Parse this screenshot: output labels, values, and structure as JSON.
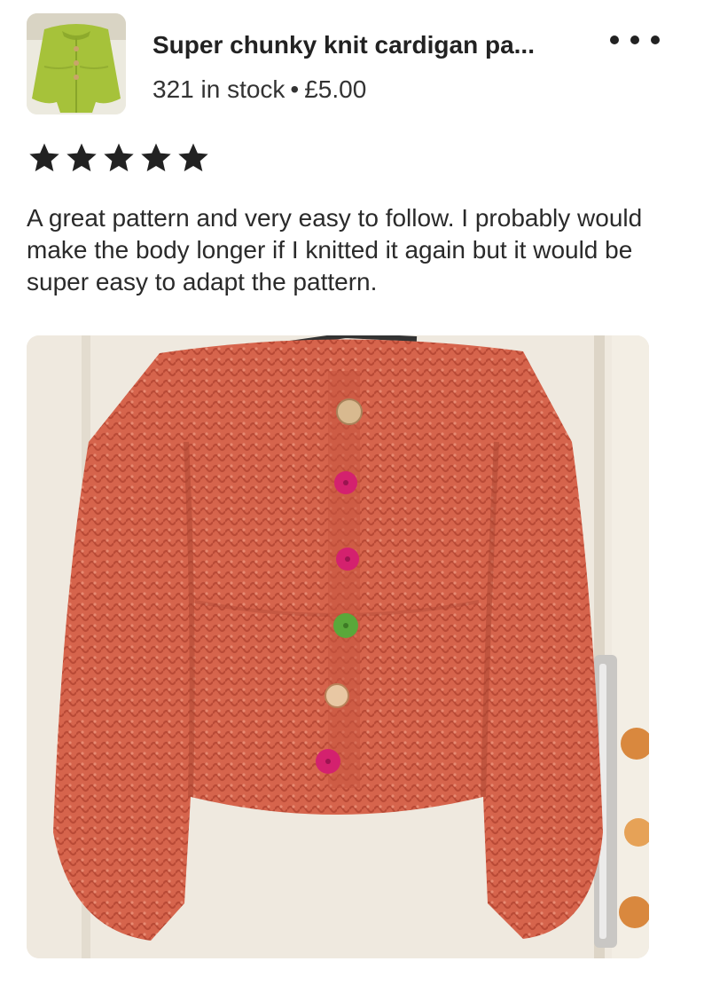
{
  "listing": {
    "title": "Super chunky knit cardigan pa...",
    "stock": "321 in stock",
    "separator": "•",
    "price": "£5.00",
    "thumbnail_icon": "cardigan-thumbnail",
    "more_icon": "more-options-icon"
  },
  "review": {
    "rating": 5,
    "max_rating": 5,
    "text": "A great pattern and very easy to follow. I probably would make the body longer if I knitted it again but it would be super easy to adapt the pattern."
  },
  "photo": {
    "subject": "knit-cardigan-photo"
  },
  "colors": {
    "star": "#222222",
    "thumb_cardigan": "#a6c23a",
    "photo_cardigan": "#d6644c",
    "button_pink": "#d4216e",
    "button_green": "#5aa83a",
    "button_beige": "#d8b98f"
  }
}
